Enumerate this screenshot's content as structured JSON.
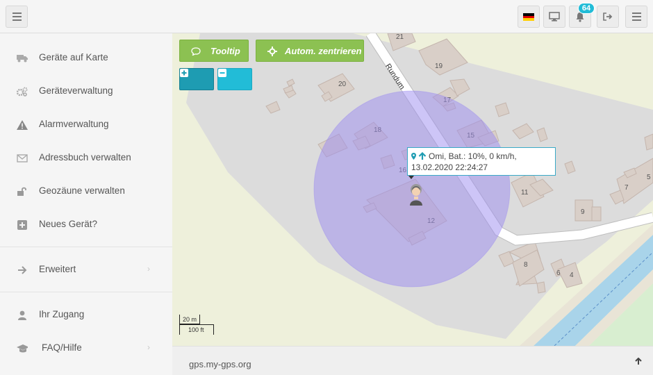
{
  "topbar": {
    "menu_toggle_icon": "hamburger-icon",
    "language_icon": "flag-de-icon",
    "display_icon": "monitor-icon",
    "notification_icon": "bell-icon",
    "notification_count": "64",
    "logout_icon": "sign-out-icon",
    "right_menu_icon": "hamburger-icon"
  },
  "sidebar": {
    "items": [
      {
        "label": "Geräte auf Karte",
        "icon": "truck-icon"
      },
      {
        "label": "Geräteverwaltung",
        "icon": "cogs-icon"
      },
      {
        "label": "Alarmverwaltung",
        "icon": "warning-icon"
      },
      {
        "label": "Adressbuch verwalten",
        "icon": "envelope-icon"
      },
      {
        "label": "Geozäune verwalten",
        "icon": "unlock-icon"
      },
      {
        "label": "Neues Gerät?",
        "icon": "plus-square-icon"
      },
      {
        "label": "Erweitert",
        "icon": "arrow-right-icon"
      },
      {
        "label": "Ihr Zugang",
        "icon": "user-icon"
      },
      {
        "label": "FAQ/Hilfe",
        "icon": "graduation-cap-icon"
      }
    ],
    "chevron": "›"
  },
  "map": {
    "buttons": {
      "tooltip": "Tooltip",
      "auto_center": "Autom. zentrieren",
      "zoom_in_icon": "plus-square-icon",
      "zoom_out_icon": "minus-square-icon"
    },
    "street_name": "Rundum",
    "house_numbers": [
      "21",
      "19",
      "20",
      "17",
      "18",
      "15",
      "16",
      "12",
      "11",
      "9",
      "7",
      "5",
      "8",
      "6",
      "4"
    ],
    "popup": {
      "line1": "Omi, Bat.: 10%, 0 km/h,",
      "line2": "13.02.2020 22:24:27"
    },
    "scale": {
      "metric": "20 m",
      "imperial": "100 ft"
    },
    "colors": {
      "geofence": "#9b8cf0",
      "land": "#eef0db",
      "area": "#dcdcdc",
      "building": "#d9cfc8",
      "road": "#ffffff",
      "water": "#a9d4ea"
    }
  },
  "footer": {
    "url": "gps.my-gps.org",
    "up_arrow": "🠝"
  }
}
